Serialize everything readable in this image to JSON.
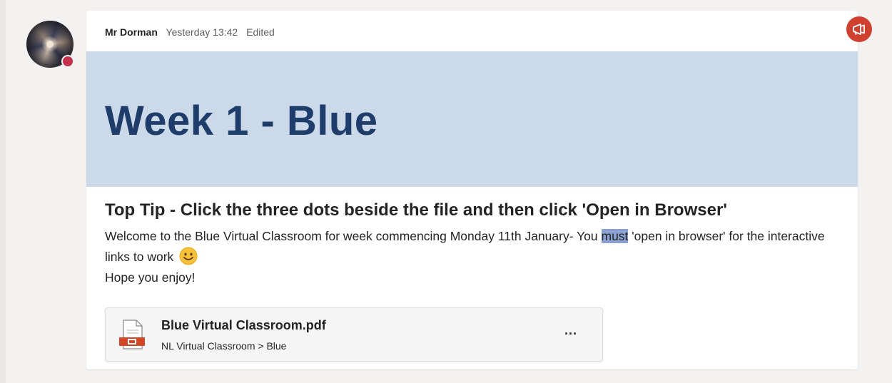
{
  "post": {
    "author": "Mr Dorman",
    "timestamp": "Yesterday 13:42",
    "edited_label": "Edited",
    "avatar_icon": "galaxy-avatar",
    "presence_color": "#c4314b",
    "announcement_icon": "megaphone-icon",
    "announcement_color": "#d0402f",
    "banner": {
      "title": "Week 1 - Blue",
      "background": "#ccd9e8",
      "title_color": "#1f3d6b"
    },
    "subject": "Top Tip - Click the three dots beside the file and then click 'Open in Browser'",
    "body": {
      "line1_before": "Welcome to the Blue Virtual Classroom for week commencing Monday 11th January- You ",
      "line1_highlight": "must",
      "line1_after": " 'open in browser' for the interactive links to work",
      "emoji": "smile-emoji",
      "line2": "Hope you enjoy!"
    },
    "attachment": {
      "file_name": "Blue Virtual Classroom.pdf",
      "path": "NL Virtual Classroom > Blue",
      "file_icon": "pdf-file-icon",
      "more_label": "...",
      "more_icon": "more-options-icon"
    }
  }
}
